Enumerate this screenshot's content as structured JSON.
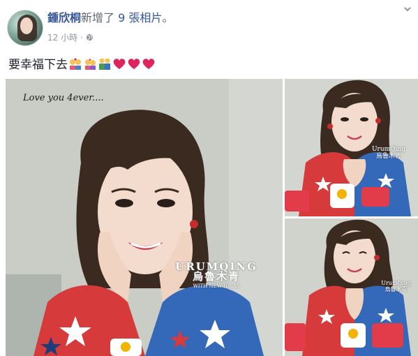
{
  "post": {
    "author": "鍾欣桐",
    "action": "新增了",
    "photo_count_text": "9 張相片",
    "action_suffix": "。",
    "timestamp": "12 小時",
    "separator": "·",
    "privacy_icon": "globe-icon",
    "caption": "要幸福下去",
    "caption_emojis": [
      "couple-with-heart-icon",
      "kiss-icon",
      "couple-icon",
      "heart-icon",
      "heart-icon",
      "heart-icon"
    ],
    "accent_color": "#365899",
    "heart_color": "#e0245e"
  },
  "photos": {
    "main": {
      "handwriting": "Love you 4ever....",
      "watermark_latin": "URUMQING",
      "watermark_cn": "烏魯木青",
      "watermark_tagline": "WITH NEW IDEAS"
    },
    "side1": {
      "watermark_latin": "UrumQing",
      "watermark_cn": "烏魯木青"
    },
    "side2": {
      "watermark_latin": "UrumQing",
      "watermark_cn": "烏魯木青"
    }
  }
}
